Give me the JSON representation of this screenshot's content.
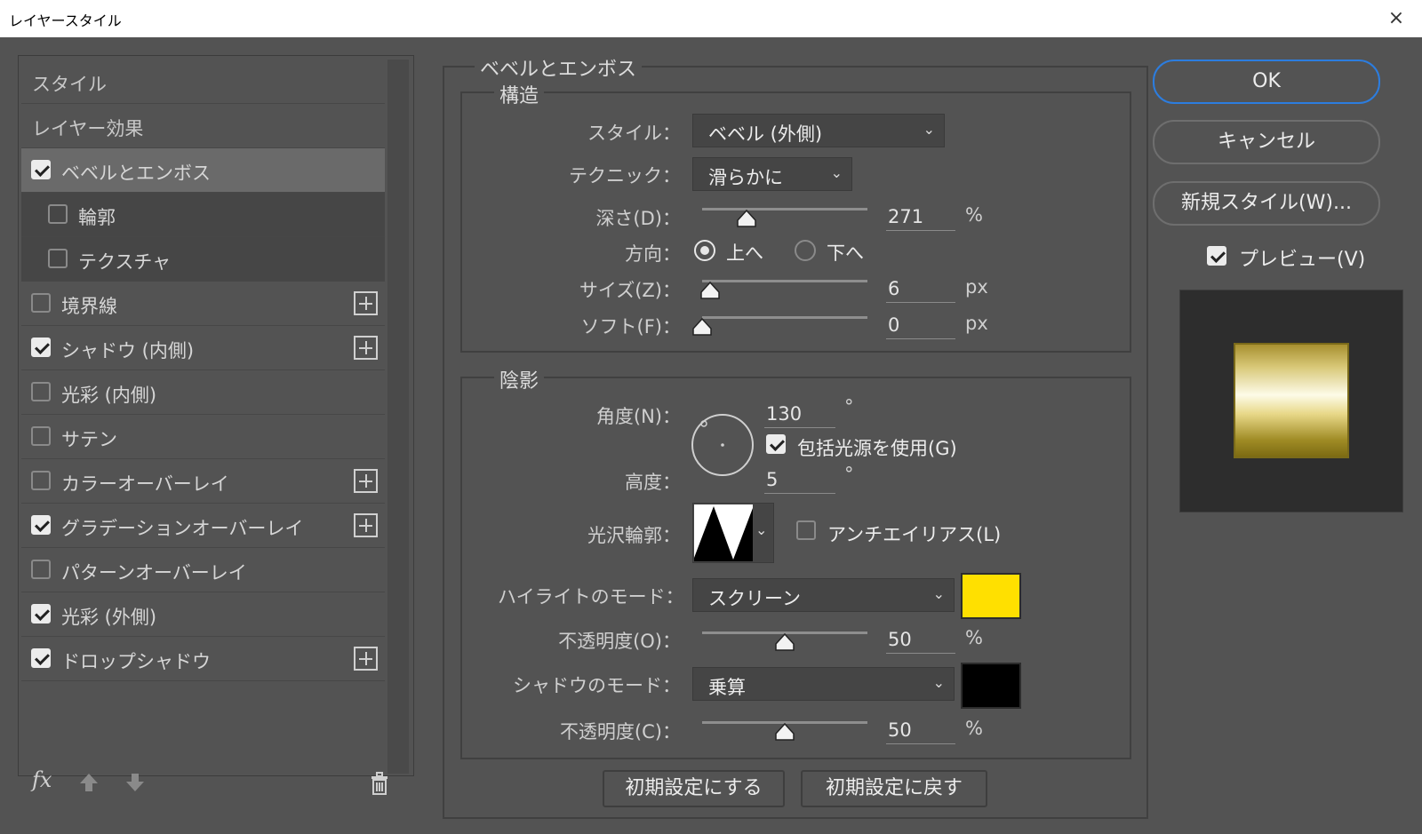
{
  "window": {
    "title": "レイヤースタイル",
    "close": "×"
  },
  "left": {
    "heading_styles": "スタイル",
    "heading_effects": "レイヤー効果",
    "items": [
      {
        "label": "ベベルとエンボス",
        "checked": true,
        "plus": false
      },
      {
        "label": "輪郭",
        "checked": false,
        "plus": false
      },
      {
        "label": "テクスチャ",
        "checked": false,
        "plus": false
      },
      {
        "label": "境界線",
        "checked": false,
        "plus": true
      },
      {
        "label": "シャドウ (内側)",
        "checked": true,
        "plus": true
      },
      {
        "label": "光彩 (内側)",
        "checked": false,
        "plus": false
      },
      {
        "label": "サテン",
        "checked": false,
        "plus": false
      },
      {
        "label": "カラーオーバーレイ",
        "checked": false,
        "plus": true
      },
      {
        "label": "グラデーションオーバーレイ",
        "checked": true,
        "plus": true
      },
      {
        "label": "パターンオーバーレイ",
        "checked": false,
        "plus": false
      },
      {
        "label": "光彩 (外側)",
        "checked": true,
        "plus": false
      },
      {
        "label": "ドロップシャドウ",
        "checked": true,
        "plus": true
      }
    ],
    "footer": {
      "fx": "fx",
      "up_icon": "arrow-up-icon",
      "down_icon": "arrow-down-icon",
      "trash_icon": "trash-icon"
    }
  },
  "bevel": {
    "section_title": "ベベルとエンボス",
    "structure": {
      "title": "構造",
      "style_label": "スタイル：",
      "style_value": "ベベル (外側)",
      "technique_label": "テクニック：",
      "technique_value": "滑らかに",
      "depth_label": "深さ(D)：",
      "depth_value": "271",
      "depth_unit": "%",
      "depth_slider": 0.27,
      "direction_label": "方向：",
      "direction_up": "上へ",
      "direction_down": "下へ",
      "direction_selected": "上へ",
      "size_label": "サイズ(Z)：",
      "size_value": "6",
      "size_unit": "px",
      "size_slider": 0.05,
      "soften_label": "ソフト(F)：",
      "soften_value": "0",
      "soften_unit": "px",
      "soften_slider": 0.0
    },
    "shading": {
      "title": "陰影",
      "angle_label": "角度(N)：",
      "angle_value": "130",
      "angle_unit": "°",
      "global_light_label": "包括光源を使用(G)",
      "global_light_checked": true,
      "altitude_label": "高度：",
      "altitude_value": "5",
      "altitude_unit": "°",
      "gloss_label": "光沢輪郭：",
      "antialias_label": "アンチエイリアス(L)",
      "antialias_checked": false,
      "highlight_mode_label": "ハイライトのモード：",
      "highlight_mode_value": "スクリーン",
      "highlight_color": "#ffe000",
      "highlight_opacity_label": "不透明度(O)：",
      "highlight_opacity_value": "50",
      "highlight_opacity_unit": "%",
      "highlight_opacity_slider": 0.5,
      "shadow_mode_label": "シャドウのモード：",
      "shadow_mode_value": "乗算",
      "shadow_color": "#000000",
      "shadow_opacity_label": "不透明度(C)：",
      "shadow_opacity_value": "50",
      "shadow_opacity_unit": "%",
      "shadow_opacity_slider": 0.5
    },
    "make_default": "初期設定にする",
    "reset_default": "初期設定に戻す"
  },
  "right": {
    "ok": "OK",
    "cancel": "キャンセル",
    "new_style": "新規スタイル(W)...",
    "preview_label": "プレビュー(V)",
    "preview_checked": true
  }
}
